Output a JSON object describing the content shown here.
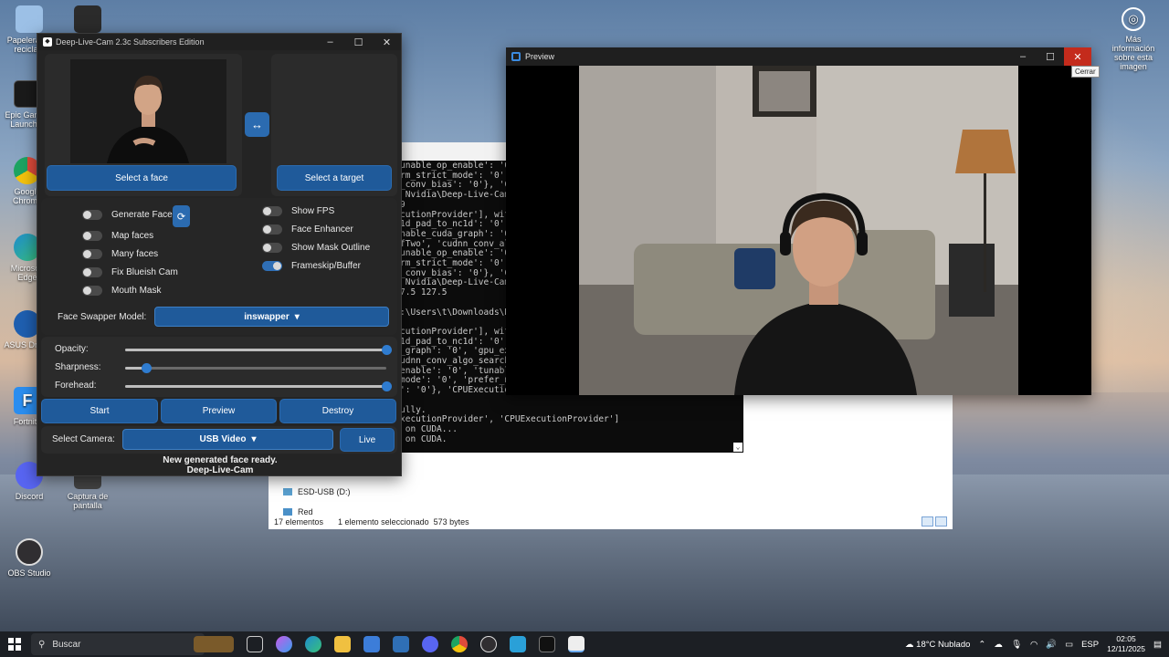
{
  "desktop": {
    "icons": [
      {
        "label": "Papelera de reciclaje",
        "color": "#9cc0e6"
      },
      {
        "label": "Epic Games Launcher",
        "color": "#1a1a1a"
      },
      {
        "label": "Google Chrome",
        "color": "#e04b3b"
      },
      {
        "label": "Microsoft Edge",
        "color": "#1f8ccf"
      },
      {
        "label": "ASUS Driver",
        "color": "#1f5fb0"
      },
      {
        "label": "Fortnite",
        "color": "#2b8ef0"
      },
      {
        "label": "Discord",
        "color": "#5865f2"
      },
      {
        "label": "OBS Studio",
        "color": "#302e31"
      },
      {
        "label": "Captura de pantalla",
        "color": "#444444"
      }
    ],
    "info_label": "Más información sobre esta imagen"
  },
  "explorer": {
    "sidebar": [
      "ESD-USB (D:)",
      "Red"
    ],
    "status_count": "17 elementos",
    "status_selected": "1 elemento seleccionado",
    "status_size": "573 bytes"
  },
  "console": {
    "text": "unable_op_enable': '0',\nrm_strict_mode': '0',\n_conv_bias': '0'}, 'CP\n Nvidia\\Deep-Live-Cam-\n9\ncutionProvider'], with\n1d_pad_to_nc1d': '0',\nnable_cuda_graph': '0'\nfTwo', 'cudnn_conv_alg\nunable_op_enable': '0'\nrm_strict_mode': '0',\n_conv_bias': '0'}, 'CP\n Nvidia\\Deep-Live-Cam-\n7.5 127.5\n\n:\\Users\\t\\Downloads\\De\n\ncutionProvider'], with\n1d_pad_to_nc1d': '0',\n_graph': '0', 'gpu_ext\nudnn_conv_algo_search'\nenable': '0', 'tunable\nmode': '0', 'prefer_nh\n': '0'}, 'CPUExecution\n\nully.\nxecutionProvider', 'CPUExecutionProvider']\n on CUDA...\n on CUDA."
  },
  "app": {
    "title": "Deep-Live-Cam 2.3c Subscribers Edition",
    "select_face": "Select a face",
    "select_target": "Select a target",
    "swap_glyph": "↔",
    "refresh_glyph": "⟳",
    "toggles_left": [
      {
        "label": "Generate Face",
        "on": false
      },
      {
        "label": "Map faces",
        "on": false
      },
      {
        "label": "Many faces",
        "on": false
      },
      {
        "label": "Fix Blueish Cam",
        "on": false
      },
      {
        "label": "Mouth Mask",
        "on": false
      }
    ],
    "toggles_right": [
      {
        "label": "Show FPS",
        "on": false
      },
      {
        "label": "Face Enhancer",
        "on": false
      },
      {
        "label": "Show Mask Outline",
        "on": false
      },
      {
        "label": "Frameskip/Buffer",
        "on": true
      }
    ],
    "model_label": "Face Swapper Model:",
    "model_value": "inswapper",
    "sliders": [
      {
        "label": "Opacity:",
        "value": 1.0
      },
      {
        "label": "Sharpness:",
        "value": 0.08
      },
      {
        "label": "Forehead:",
        "value": 1.0
      }
    ],
    "start": "Start",
    "preview": "Preview",
    "destroy": "Destroy",
    "camera_label": "Select Camera:",
    "camera_value": "USB Video",
    "live": "Live",
    "status_line1": "New generated face ready.",
    "status_line2": "Deep-Live-Cam"
  },
  "preview_window": {
    "title": "Preview",
    "close_tooltip": "Cerrar"
  },
  "taskbar": {
    "search_placeholder": "Buscar",
    "weather": "18°C  Nublado",
    "lang": "ESP",
    "time": "02:05",
    "date": "12/11/2025",
    "weather_badge": "2"
  }
}
